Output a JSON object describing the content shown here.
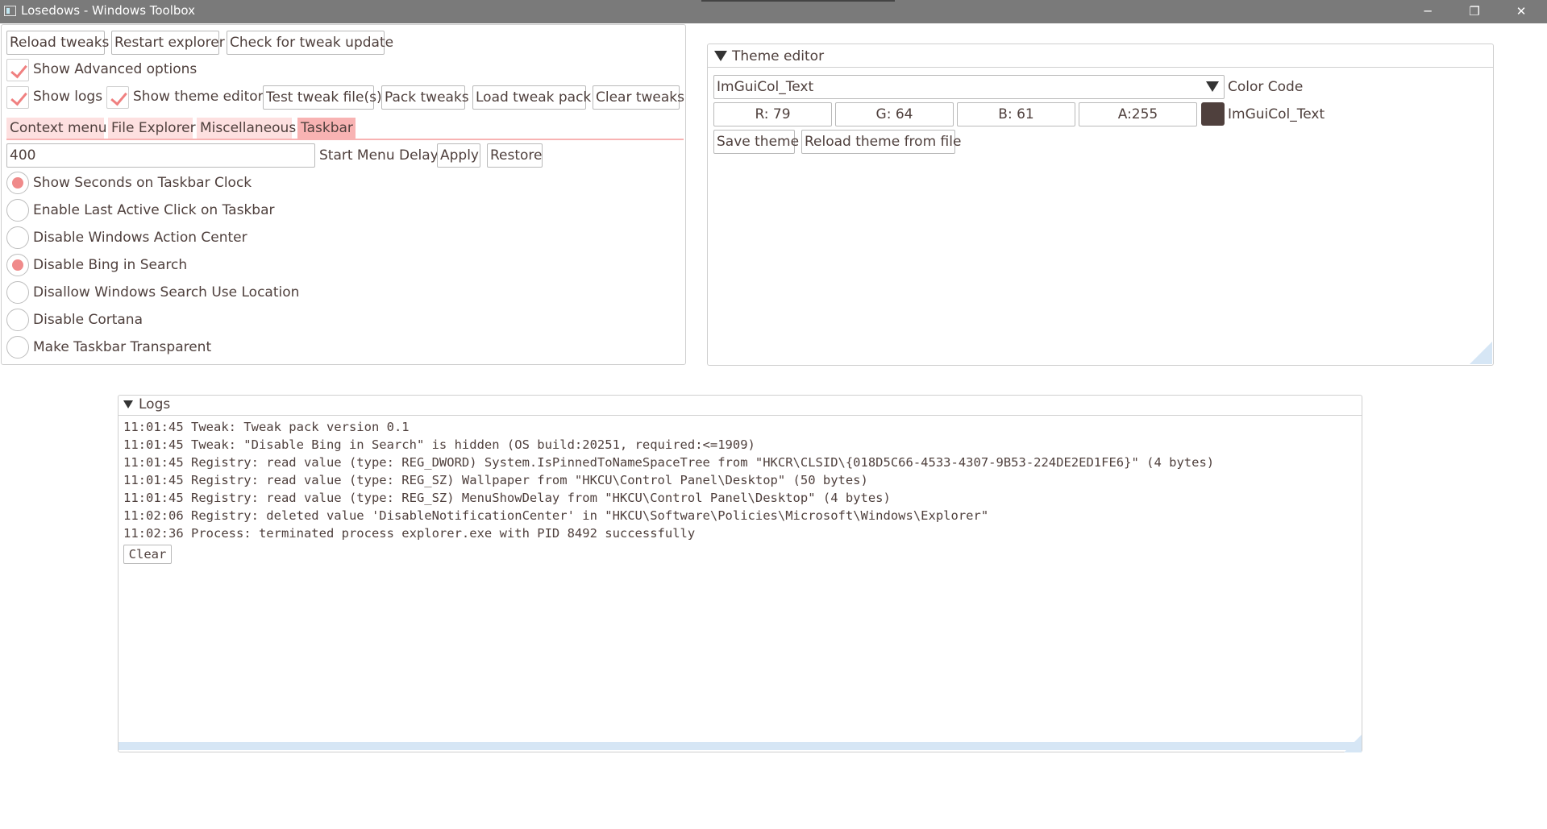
{
  "window": {
    "title": "Losedows - Windows Toolbox",
    "controls": {
      "minimize": "─",
      "maximize": "❐",
      "close": "✕"
    }
  },
  "toolbar": {
    "reload_tweaks": "Reload tweaks",
    "restart_explorer": "Restart explorer",
    "check_update": "Check for tweak update",
    "show_advanced": "Show Advanced options",
    "show_logs": "Show logs",
    "show_theme_editor": "Show theme editor",
    "test_tweak_files": "Test tweak file(s)",
    "pack_tweaks": "Pack tweaks",
    "load_tweak_pack": "Load tweak pack",
    "clear_tweaks": "Clear tweaks"
  },
  "tabs": [
    {
      "label": "Context menu",
      "active": false
    },
    {
      "label": "File Explorer",
      "active": false
    },
    {
      "label": "Miscellaneous",
      "active": false
    },
    {
      "label": "Taskbar",
      "active": true
    }
  ],
  "start_menu": {
    "value": "400",
    "label": "Start Menu Delay",
    "apply": "Apply",
    "restore": "Restore"
  },
  "options": [
    {
      "label": "Show Seconds on Taskbar Clock",
      "selected": true
    },
    {
      "label": "Enable Last Active Click on Taskbar",
      "selected": false
    },
    {
      "label": "Disable Windows Action Center",
      "selected": false
    },
    {
      "label": "Disable Bing in Search",
      "selected": true
    },
    {
      "label": "Disallow Windows Search Use Location",
      "selected": false
    },
    {
      "label": "Disable Cortana",
      "selected": false
    },
    {
      "label": "Make Taskbar Transparent",
      "selected": false
    }
  ],
  "theme_editor": {
    "title": "Theme editor",
    "selected_color": "ImGuiCol_Text",
    "color_code_label": "Color Code",
    "r": "R: 79",
    "g": "G: 64",
    "b": "B: 61",
    "a": "A:255",
    "swatch_color": "#4f403d",
    "swatch_label": "ImGuiCol_Text",
    "save": "Save theme",
    "reload": "Reload theme from file"
  },
  "logs": {
    "title": "Logs",
    "lines": [
      "11:01:45 Tweak: Tweak pack version 0.1",
      "11:01:45 Tweak: \"Disable Bing in Search\" is hidden (OS build:20251, required:<=1909)",
      "11:01:45 Registry: read value (type: REG_DWORD) System.IsPinnedToNameSpaceTree from \"HKCR\\CLSID\\{018D5C66-4533-4307-9B53-224DE2ED1FE6}\" (4 bytes)",
      "11:01:45 Registry: read value (type: REG_SZ) Wallpaper from \"HKCU\\Control Panel\\Desktop\" (50 bytes)",
      "11:01:45 Registry: read value (type: REG_SZ) MenuShowDelay from \"HKCU\\Control Panel\\Desktop\" (4 bytes)",
      "11:02:06 Registry: deleted value 'DisableNotificationCenter' in \"HKCU\\Software\\Policies\\Microsoft\\Windows\\Explorer\"",
      "11:02:36 Process: terminated process explorer.exe with PID 8492 successfully"
    ],
    "clear": "Clear"
  },
  "colors": {
    "accent": "#f08080",
    "tab_bg": "#fde0e0",
    "tab_active": "#f8b3b3",
    "text": "#4f403d"
  }
}
